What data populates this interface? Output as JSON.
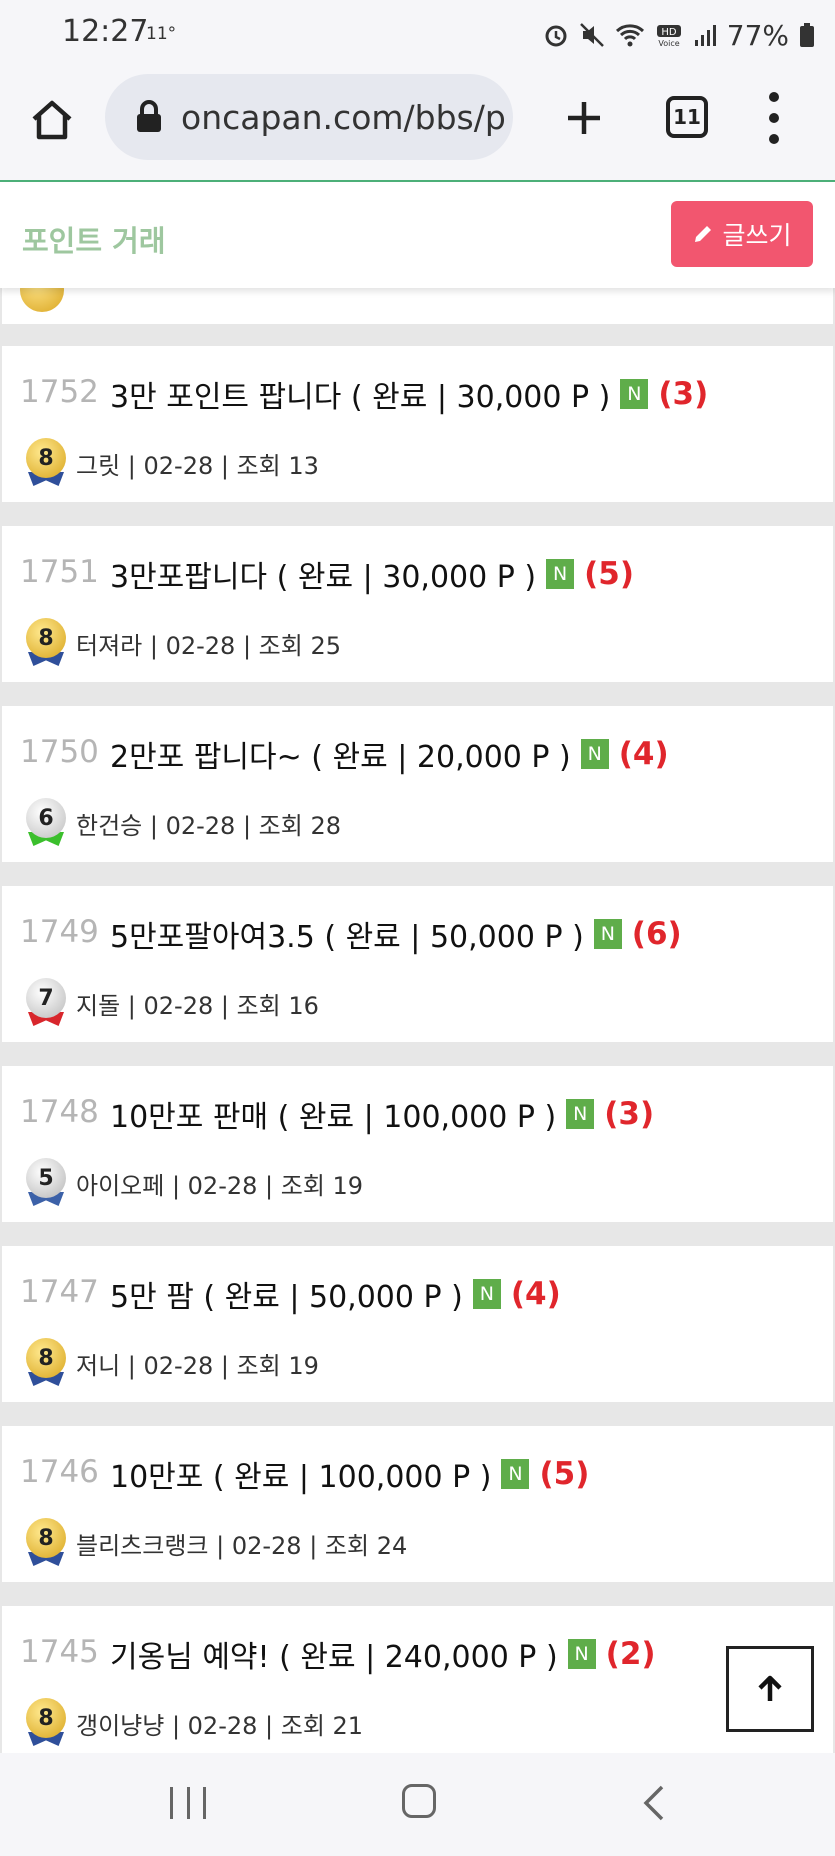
{
  "status_bar": {
    "time": "12:27",
    "temperature": "11°",
    "battery": "77%"
  },
  "browser": {
    "url": "oncapan.com/bbs/p",
    "tab_count": "11"
  },
  "board": {
    "title": "포인트 거래",
    "write_button": "글쓰기"
  },
  "posts": [
    {
      "num": "1752",
      "title": "3만 포인트 팝니다 ( 완료 | 30,000 P )",
      "badge": "N",
      "comments": "(3)",
      "level": "8",
      "meta": "그릿 | 02-28 | 조회 13"
    },
    {
      "num": "1751",
      "title": "3만포팝니다 ( 완료 | 30,000 P )",
      "badge": "N",
      "comments": "(5)",
      "level": "8",
      "meta": "터져라 | 02-28 | 조회 25"
    },
    {
      "num": "1750",
      "title": "2만포 팝니다~ ( 완료 | 20,000 P )",
      "badge": "N",
      "comments": "(4)",
      "level": "6",
      "meta": "한건승 | 02-28 | 조회 28"
    },
    {
      "num": "1749",
      "title": "5만포팔아여3.5 ( 완료 | 50,000 P )",
      "badge": "N",
      "comments": "(6)",
      "level": "7",
      "meta": "지돌 | 02-28 | 조회 16"
    },
    {
      "num": "1748",
      "title": "10만포 판매 ( 완료 | 100,000 P )",
      "badge": "N",
      "comments": "(3)",
      "level": "5",
      "meta": "아이오페 | 02-28 | 조회 19"
    },
    {
      "num": "1747",
      "title": "5만 팜 ( 완료 | 50,000 P )",
      "badge": "N",
      "comments": "(4)",
      "level": "8",
      "meta": "저니 | 02-28 | 조회 19"
    },
    {
      "num": "1746",
      "title": "10만포 ( 완료 | 100,000 P )",
      "badge": "N",
      "comments": "(5)",
      "level": "8",
      "meta": "블리츠크랭크 | 02-28 | 조회 24"
    },
    {
      "num": "1745",
      "title": "기옹님 예약! ( 완료 | 240,000 P )",
      "badge": "N",
      "comments": "(2)",
      "level": "8",
      "meta": "갱이냥냥 | 02-28 | 조회 21"
    }
  ],
  "colors": {
    "accent_title": "#9ec79f",
    "write_button": "#f2566f",
    "new_badge": "#5fad4a",
    "comment_count": "#e0262c"
  }
}
